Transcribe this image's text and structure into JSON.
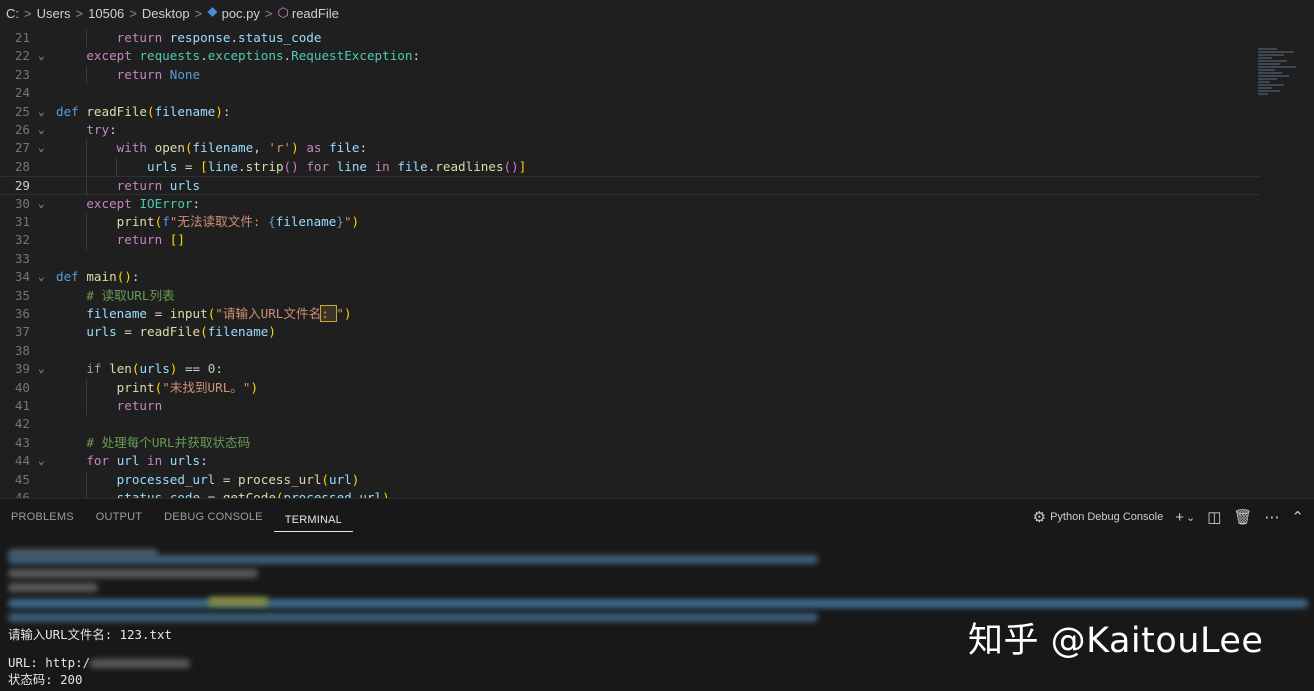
{
  "breadcrumb": {
    "parts": [
      "C:",
      "Users",
      "10506",
      "Desktop"
    ],
    "file": "poc.py",
    "symbol": "readFile",
    "separator": ">"
  },
  "editor": {
    "active_line": 29
  },
  "panel": {
    "tabs": [
      {
        "label": "PROBLEMS",
        "active": false
      },
      {
        "label": "OUTPUT",
        "active": false
      },
      {
        "label": "DEBUG CONSOLE",
        "active": false
      },
      {
        "label": "TERMINAL",
        "active": true
      }
    ],
    "debug_console_label": "Python Debug Console",
    "icons": [
      "debug-gear-icon",
      "plus-icon",
      "chevron-down-icon",
      "split-icon",
      "trash-icon",
      "ellipsis-icon",
      "chevron-up-icon"
    ]
  },
  "terminal": {
    "prompt_line": "请输入URL文件名: 123.txt",
    "url_label": "URL: http:/",
    "status_line": "状态码: 200"
  },
  "watermark": "知乎 @KaitouLee"
}
